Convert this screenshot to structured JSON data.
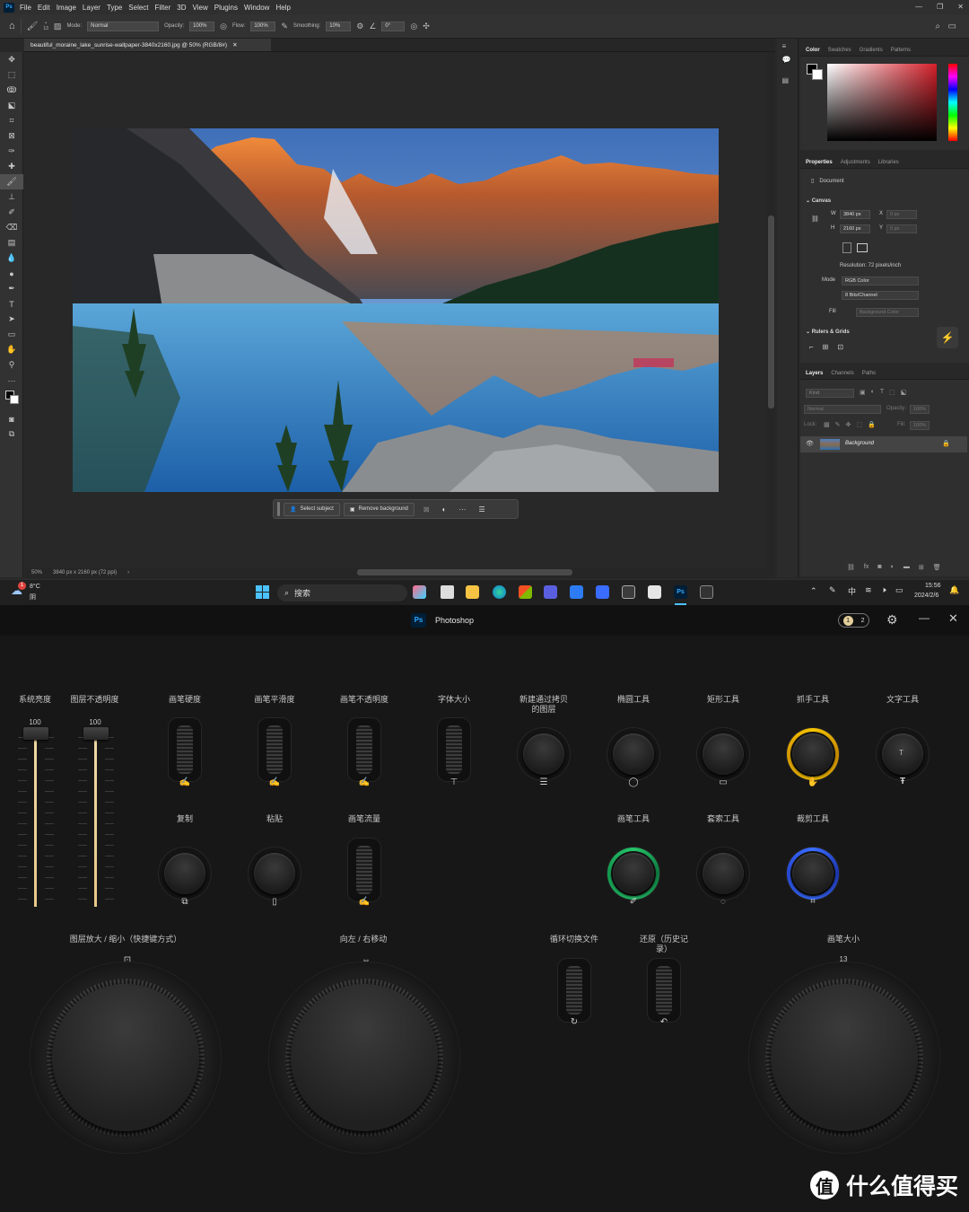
{
  "ps": {
    "menu": [
      "File",
      "Edit",
      "Image",
      "Layer",
      "Type",
      "Select",
      "Filter",
      "3D",
      "View",
      "Plugins",
      "Window",
      "Help"
    ],
    "options": {
      "brush_size": "13",
      "mode_label": "Mode:",
      "mode_value": "Normal",
      "opacity_label": "Opacity:",
      "opacity_value": "100%",
      "flow_label": "Flow:",
      "flow_value": "100%",
      "smoothing_label": "Smoothing:",
      "smoothing_value": "10%",
      "angle_value": "0°"
    },
    "doc_tab": "beautiful_moraine_lake_sunrise-wallpaper-3840x2160.jpg @ 50% (RGB/8#)",
    "context_bar": {
      "select_subject": "Select subject",
      "remove_background": "Remove background"
    },
    "status": {
      "zoom": "50%",
      "doc_info": "3840 px x 2160 px (72 ppi)"
    },
    "color_tabs": [
      "Color",
      "Swatches",
      "Gradients",
      "Patterns"
    ],
    "props_tabs": [
      "Properties",
      "Adjustments",
      "Libraries"
    ],
    "props": {
      "document": "Document",
      "canvas": "Canvas",
      "w_label": "W",
      "w_value": "3840 px",
      "h_label": "H",
      "h_value": "2160 px",
      "x_label": "X",
      "x_value": "0 px",
      "y_label": "Y",
      "y_value": "0 px",
      "resolution": "Resolution: 72 pixels/inch",
      "mode_label": "Mode",
      "mode_value": "RGB Color",
      "depth_value": "8 Bits/Channel",
      "fill_label": "Fill",
      "fill_value": "Background Color",
      "rulers": "Rulers & Grids"
    },
    "layer_tabs": [
      "Layers",
      "Channels",
      "Paths"
    ],
    "layers": {
      "kind": "Kind",
      "blend": "Normal",
      "opacity_label": "Opacity:",
      "opacity_value": "100%",
      "lock_label": "Lock:",
      "fill_label": "Fill:",
      "fill_value": "100%",
      "layer_name": "Background"
    }
  },
  "taskbar": {
    "weather_temp": "8°C",
    "weather_cond": "阴",
    "weather_badge": "1",
    "search": "搜索",
    "ime": "中",
    "time": "15:56",
    "date": "2024/2/6"
  },
  "console": {
    "app_name": "Photoshop",
    "app_icon": "Ps",
    "badge_1": "1",
    "badge_2": "2",
    "sliders": [
      {
        "label": "系统亮度",
        "value": "100",
        "level": 1.0
      },
      {
        "label": "图层不透明度",
        "value": "100",
        "level": 1.0
      }
    ],
    "row1": [
      {
        "label": "画笔硬度",
        "type": "wheel",
        "icon": "brush-icon"
      },
      {
        "label": "画笔平滑度",
        "type": "wheel",
        "icon": "brush-icon"
      },
      {
        "label": "画笔不透明度",
        "type": "wheel",
        "icon": "brush-icon"
      },
      {
        "label": "字体大小",
        "type": "wheel",
        "icon": "text-box-icon"
      },
      {
        "label": "新建通过拷贝的图层",
        "type": "knob",
        "icon": "layers-icon"
      },
      {
        "label": "椭圆工具",
        "type": "knob",
        "icon": "ellipse-icon"
      },
      {
        "label": "矩形工具",
        "type": "knob",
        "icon": "rectangle-icon"
      },
      {
        "label": "抓手工具",
        "type": "knob",
        "icon": "hand-icon",
        "ring": "#f5c400"
      },
      {
        "label": "文字工具",
        "type": "knob",
        "icon": "type-icon"
      }
    ],
    "type_knob_glyph": "T",
    "row2": [
      {
        "label": "复制",
        "type": "knob",
        "icon": "copy-icon"
      },
      {
        "label": "粘贴",
        "type": "knob",
        "icon": "paste-icon"
      },
      {
        "label": "画笔流量",
        "type": "wheel",
        "icon": "brush-icon"
      },
      {
        "label": "画笔工具",
        "type": "knob",
        "icon": "brush-tool-icon",
        "ring": "#25c46a"
      },
      {
        "label": "套索工具",
        "type": "knob",
        "icon": "lasso-icon"
      },
      {
        "label": "裁剪工具",
        "type": "knob",
        "icon": "crop-icon",
        "ring": "#3a6dff"
      }
    ],
    "row3": [
      {
        "label": "图层放大 / 缩小（快捷键方式）",
        "type": "dial",
        "icon": "zoom-icon"
      },
      {
        "label": "向左 / 右移动",
        "type": "dial",
        "icon": "move-horizontal-icon"
      },
      {
        "label": "循环切换文件",
        "type": "wheel",
        "icon": "cycle-icon"
      },
      {
        "label": "还原（历史记录）",
        "type": "wheel",
        "icon": "undo-icon"
      },
      {
        "label": "画笔大小",
        "type": "dial",
        "value": "13"
      }
    ]
  },
  "watermark": {
    "glyph": "值",
    "text": "什么值得买"
  }
}
